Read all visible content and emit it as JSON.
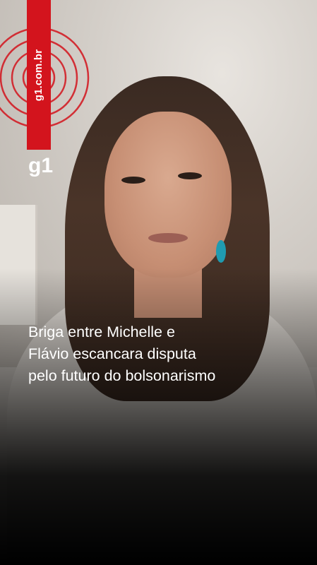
{
  "brand": {
    "url": "g1.com.br",
    "logo": "g1",
    "accent_color": "#d3141d"
  },
  "headline": {
    "lines": [
      "Briga entre Michelle e",
      "Flávio escancara disputa",
      "pelo futuro do bolsonarismo"
    ]
  }
}
